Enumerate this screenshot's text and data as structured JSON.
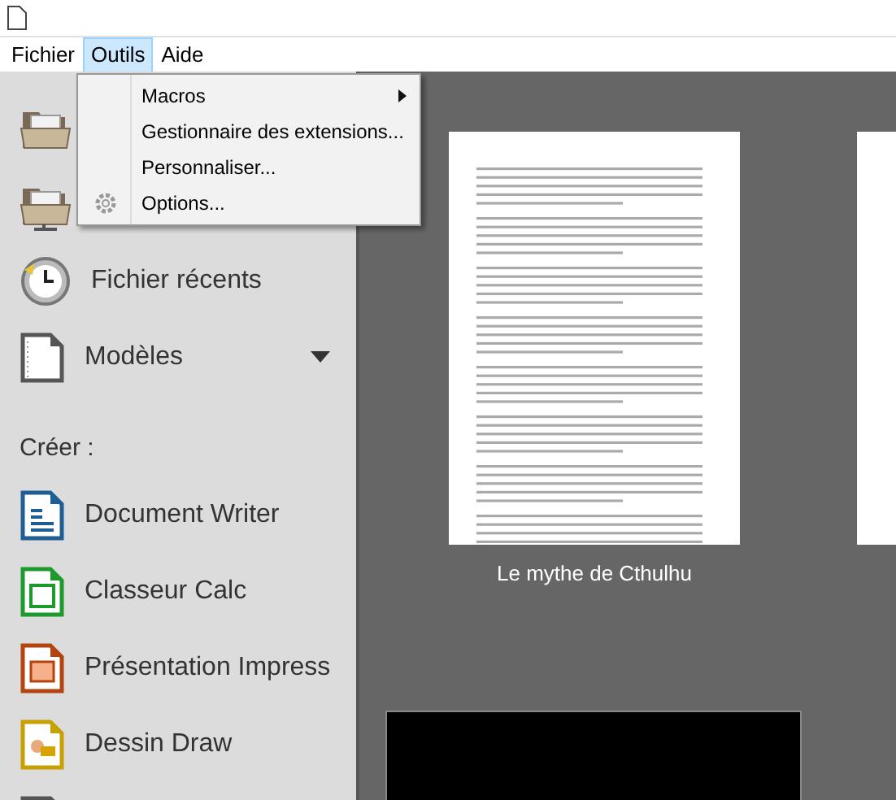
{
  "menu_bar": [
    {
      "label": "Fichier",
      "selected": false
    },
    {
      "label": "Outils",
      "selected": true
    },
    {
      "label": "Aide",
      "selected": false
    }
  ],
  "open_menu": {
    "items": [
      {
        "label": "Macros",
        "submenu": true
      },
      {
        "label": "Gestionnaire des extensions...",
        "submenu": false
      },
      {
        "label": "Personnaliser...",
        "submenu": false
      },
      {
        "label": "Options...",
        "submenu": false
      }
    ]
  },
  "sidebar": {
    "items": [
      {
        "kind": "icon_only"
      },
      {
        "kind": "icon_only"
      },
      {
        "kind": "entry",
        "label": "Fichier récents"
      },
      {
        "kind": "dropdown",
        "label": "Modèles"
      },
      {
        "kind": "divider"
      },
      {
        "kind": "heading",
        "label": "Créer :"
      },
      {
        "kind": "entry",
        "label": "Document Writer"
      },
      {
        "kind": "entry",
        "label": "Classeur Calc"
      },
      {
        "kind": "entry",
        "label": "Présentation Impress"
      },
      {
        "kind": "entry",
        "label": "Dessin Draw"
      },
      {
        "kind": "icon_only"
      }
    ]
  },
  "documents": [
    {
      "title": "Le mythe de Cthulhu"
    }
  ]
}
